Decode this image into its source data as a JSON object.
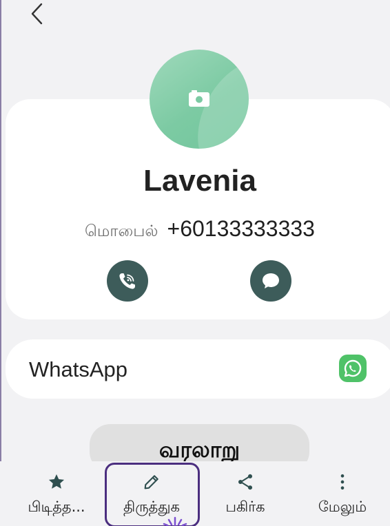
{
  "contact": {
    "name": "Lavenia",
    "phone_label": "மொபைல்",
    "phone_number": "+60133333333"
  },
  "linked_apps": {
    "whatsapp_label": "WhatsApp"
  },
  "history_button_label": "வரலாறு",
  "bottom_nav": {
    "favourite": "பிடித்த...",
    "edit": "திருத்துக",
    "share": "பகிர்க",
    "more": "மேலும்"
  },
  "colors": {
    "avatar": "#7ccaa3",
    "action_button": "#3d5c5a",
    "whatsapp": "#4fc268",
    "highlight": "#4b2e7f"
  },
  "icons": [
    "back-icon",
    "camera-icon",
    "wifi-call-icon",
    "message-icon",
    "whatsapp-icon",
    "star-icon",
    "pencil-icon",
    "share-icon",
    "more-vertical-icon"
  ]
}
